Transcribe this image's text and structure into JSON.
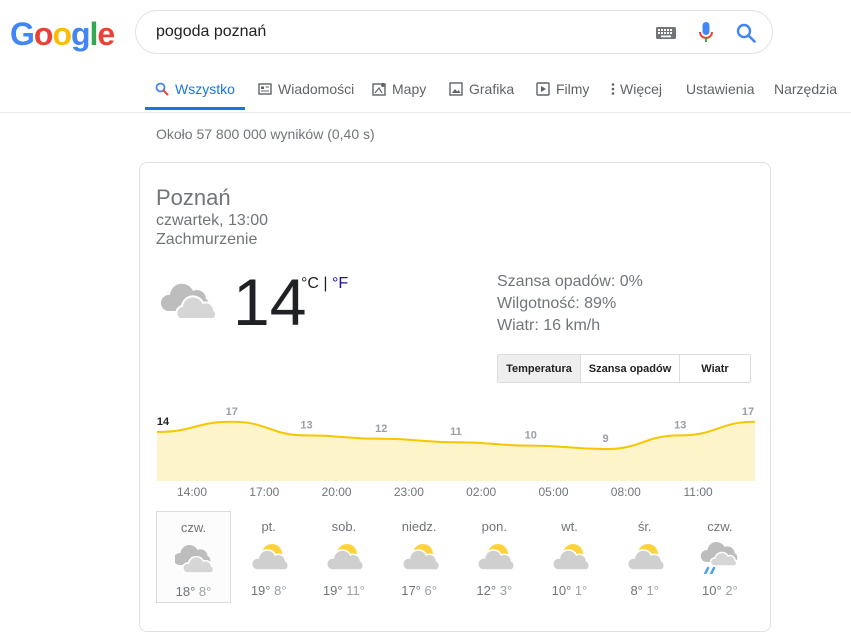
{
  "logo": "Google",
  "search": {
    "query": "pogoda poznań"
  },
  "tabs": [
    {
      "label": "Wszystko",
      "icon": "search-icon"
    },
    {
      "label": "Wiadomości",
      "icon": "news-icon"
    },
    {
      "label": "Mapy",
      "icon": "map-icon"
    },
    {
      "label": "Grafika",
      "icon": "image-icon"
    },
    {
      "label": "Filmy",
      "icon": "video-icon"
    },
    {
      "label": "Więcej",
      "icon": "more-vert-icon"
    },
    {
      "label": "Ustawienia"
    },
    {
      "label": "Narzędzia"
    }
  ],
  "result_stats": "Około 57 800 000 wyników (0,40 s)",
  "weather": {
    "location": "Poznań",
    "datetime": "czwartek, 13:00",
    "condition": "Zachmurzenie",
    "temp": "14",
    "unit_c": "°C",
    "unit_sep": " | ",
    "unit_f": "°F",
    "precip": "Szansa opadów: 0%",
    "humidity": "Wilgotność: 89%",
    "wind": "Wiatr: 16 km/h",
    "toggles": [
      "Temperatura",
      "Szansa opadów",
      "Wiatr"
    ],
    "graph_values": [
      14,
      17,
      13,
      12,
      11,
      10,
      9,
      13,
      17
    ],
    "hours": [
      "14:00",
      "17:00",
      "20:00",
      "23:00",
      "02:00",
      "05:00",
      "08:00",
      "11:00"
    ],
    "days": [
      {
        "name": "czw.",
        "hi": "18°",
        "lo": "8°",
        "icon": "cloudy-icon"
      },
      {
        "name": "pt.",
        "hi": "19°",
        "lo": "8°",
        "icon": "partly-cloudy-icon"
      },
      {
        "name": "sob.",
        "hi": "19°",
        "lo": "11°",
        "icon": "partly-cloudy-icon"
      },
      {
        "name": "niedz.",
        "hi": "17°",
        "lo": "6°",
        "icon": "partly-cloudy-icon"
      },
      {
        "name": "pon.",
        "hi": "12°",
        "lo": "3°",
        "icon": "partly-cloudy-icon"
      },
      {
        "name": "wt.",
        "hi": "10°",
        "lo": "1°",
        "icon": "partly-cloudy-icon"
      },
      {
        "name": "śr.",
        "hi": "8°",
        "lo": "1°",
        "icon": "partly-cloudy-icon"
      },
      {
        "name": "czw.",
        "hi": "10°",
        "lo": "2°",
        "icon": "rain-icon"
      }
    ]
  },
  "colors": {
    "blue": "#4285F4",
    "red": "#EA4335",
    "yellow": "#FBBC05",
    "green": "#34A853",
    "accent": "#1a73e8",
    "graph_line": "#f7c600",
    "graph_fill": "#fdf4c9"
  }
}
